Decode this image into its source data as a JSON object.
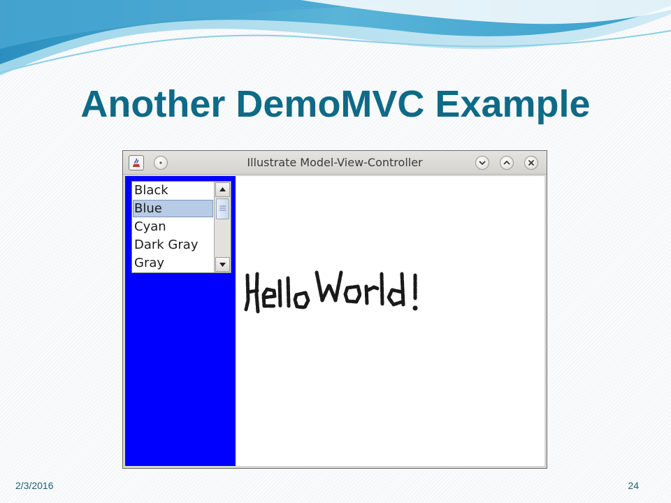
{
  "slide": {
    "title": "Another DemoMVC Example",
    "date": "2/3/2016",
    "page_number": "24"
  },
  "window": {
    "title": "Illustrate Model-View-Controller",
    "icons": {
      "app": "java-app-icon",
      "menu": "window-menu-icon",
      "minimize": "chevron-down-icon",
      "maximize": "chevron-up-icon",
      "close": "close-icon"
    }
  },
  "color_list": {
    "items": [
      "Black",
      "Blue",
      "Cyan",
      "Dark Gray",
      "Gray"
    ],
    "selected": "Blue",
    "scrollbar": {
      "up_icon": "scroll-up-arrow-icon",
      "down_icon": "scroll-down-arrow-icon"
    }
  },
  "panel": {
    "background_color": "#0000ff"
  },
  "drawing": {
    "description_text": "HelloWorld!",
    "stroke_color": "#1a1a1a"
  }
}
